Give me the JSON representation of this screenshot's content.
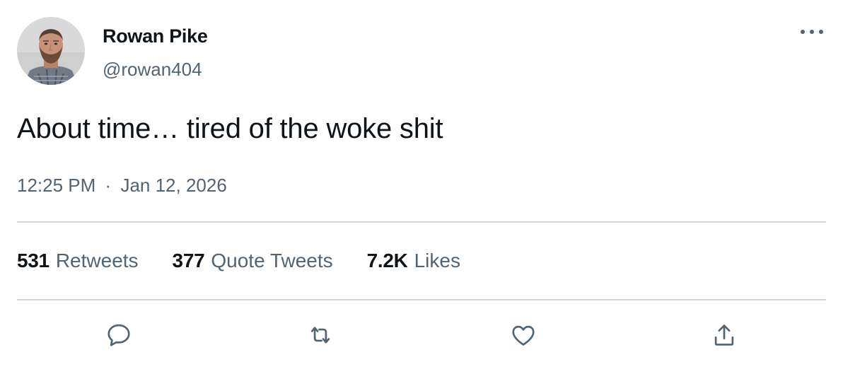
{
  "user": {
    "display_name": "Rowan Pike",
    "handle": "@rowan404",
    "avatar_icon": "profile-photo"
  },
  "tweet": {
    "text": "About time… tired of the woke shit",
    "time": "12:25 PM",
    "separator": "·",
    "date": "Jan 12, 2026"
  },
  "stats": {
    "retweets_count": "531",
    "retweets_label": "Retweets",
    "quotes_count": "377",
    "quotes_label": "Quote Tweets",
    "likes_count": "7.2K",
    "likes_label": "Likes"
  },
  "actions": {
    "reply_icon": "reply-icon",
    "retweet_icon": "retweet-icon",
    "like_icon": "heart-icon",
    "share_icon": "share-icon",
    "more_icon": "more-icon"
  },
  "colors": {
    "text": "#0f1419",
    "secondary": "#536471",
    "divider": "#cfd9de"
  }
}
